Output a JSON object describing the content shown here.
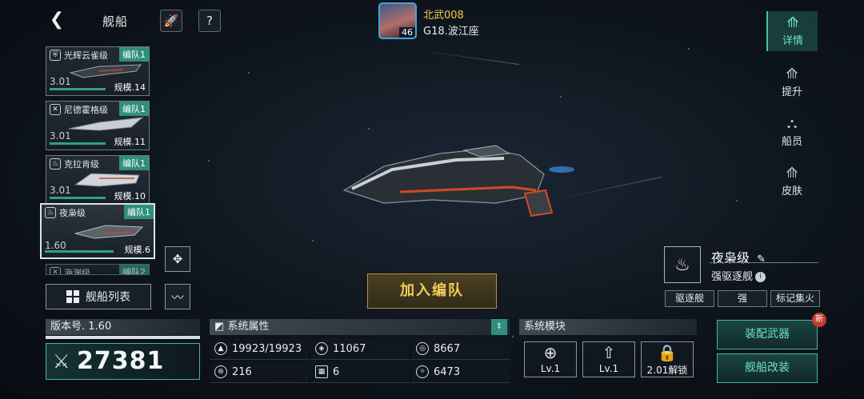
{
  "header": {
    "title": "舰船",
    "player_name": "北武008",
    "player_level": "46",
    "player_location": "G18.波江座"
  },
  "ship_list": [
    {
      "name": "光辉云雀级",
      "tag": "编队1",
      "version": "3.01",
      "scale": "规模.14",
      "icon": "shield-icon"
    },
    {
      "name": "尼德霍格级",
      "tag": "编队1",
      "version": "3.01",
      "scale": "规模.11",
      "icon": "cross-circle-icon"
    },
    {
      "name": "克拉肯级",
      "tag": "编队1",
      "version": "3.01",
      "scale": "规模.10",
      "icon": "flame-icon"
    },
    {
      "name": "夜枭级",
      "tag": "编队1",
      "version": "1.60",
      "scale": "规模.6",
      "icon": "flame-icon"
    }
  ],
  "partial_card": {
    "name": "海渊级",
    "tag": "编队2"
  },
  "ship_list_button": "舰船列表",
  "right_nav": [
    {
      "label": "详情",
      "icon": "ship-detail-icon",
      "active": true
    },
    {
      "label": "提升",
      "icon": "upgrade-icon",
      "active": false
    },
    {
      "label": "船员",
      "icon": "crew-icon",
      "active": false
    },
    {
      "label": "皮肤",
      "icon": "skin-icon",
      "active": false
    }
  ],
  "ship_info": {
    "name": "夜枭级",
    "type": "强驱逐舰",
    "traits": [
      "驱逐舰",
      "强",
      "标记集火"
    ]
  },
  "join_fleet_button": "加入编队",
  "version_panel": {
    "label": "版本号. 1.60",
    "power": "27381"
  },
  "system_attributes": {
    "title": "系统属性",
    "stats": [
      {
        "icon": "hull-icon",
        "value": "19923/19923"
      },
      {
        "icon": "armor-icon",
        "value": "11067"
      },
      {
        "icon": "shield-stat-icon",
        "value": "8667"
      },
      {
        "icon": "energy-icon",
        "value": "216"
      },
      {
        "icon": "checker-icon",
        "value": "6"
      },
      {
        "icon": "speed-icon",
        "value": "6473"
      }
    ]
  },
  "system_modules": {
    "title": "系统模块",
    "modules": [
      {
        "icon": "targeting-module-icon",
        "label": "Lv.1"
      },
      {
        "icon": "engine-module-icon",
        "label": "Lv.1"
      },
      {
        "icon": "lock-icon",
        "label": "2.01解锁"
      }
    ]
  },
  "actions": {
    "equip_weapons": "装配武器",
    "ship_modify": "舰船改装",
    "new_badge": "新"
  },
  "colors": {
    "accent_teal": "#43c2ab",
    "gold": "#f3cd58",
    "name_gold": "#f3c94f",
    "badge_red": "#c63b2f"
  }
}
